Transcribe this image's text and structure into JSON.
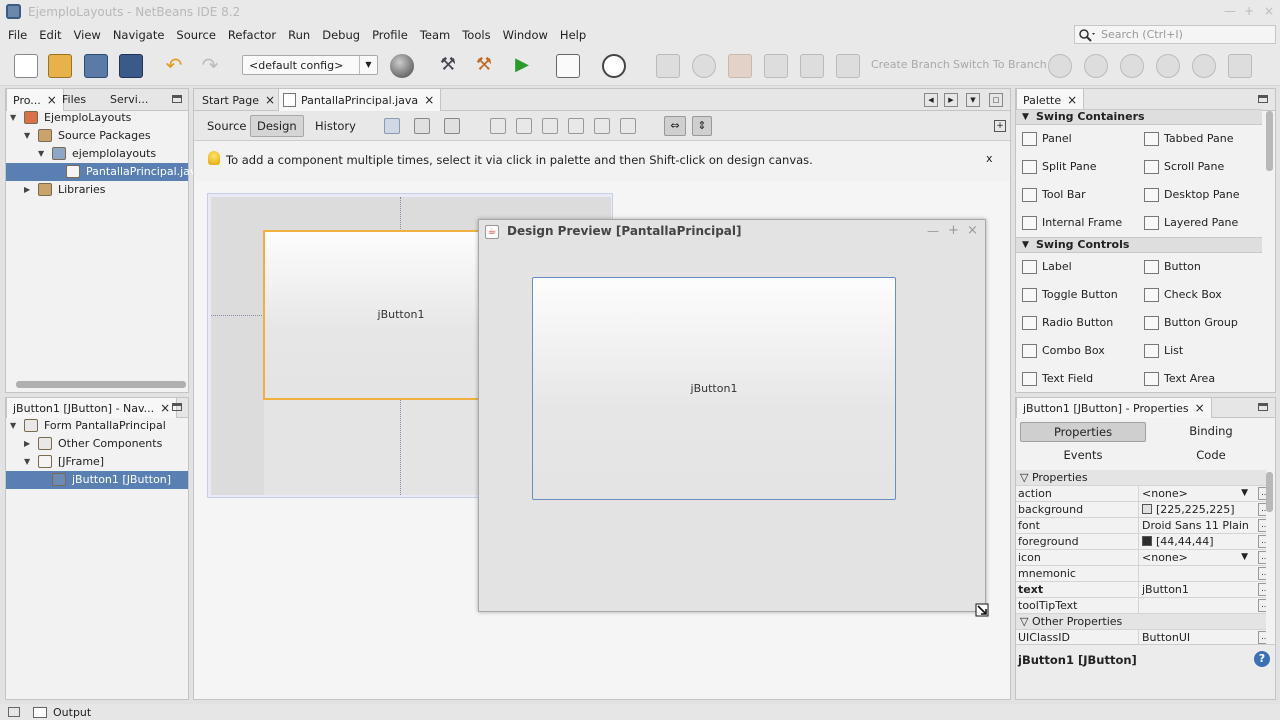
{
  "window": {
    "title": "EjemploLayouts - NetBeans IDE 8.2"
  },
  "menu": [
    "File",
    "Edit",
    "View",
    "Navigate",
    "Source",
    "Refactor",
    "Run",
    "Debug",
    "Profile",
    "Team",
    "Tools",
    "Window",
    "Help"
  ],
  "search": {
    "placeholder": "Search (Ctrl+I)"
  },
  "toolbar": {
    "config": "<default config>",
    "create_branch": "Create Branch",
    "switch_branch": "Switch To Branch"
  },
  "projects": {
    "tabs": [
      "Pro...",
      "Files",
      "Servi..."
    ],
    "tree": [
      {
        "label": "EjemploLayouts",
        "level": 0
      },
      {
        "label": "Source Packages",
        "level": 1
      },
      {
        "label": "ejemplolayouts",
        "level": 2
      },
      {
        "label": "PantallaPrincipal.java",
        "level": 3,
        "selected": true
      },
      {
        "label": "Libraries",
        "level": 1
      }
    ]
  },
  "navigator": {
    "title": "jButton1 [JButton] - Nav...",
    "tree": [
      {
        "label": "Form PantallaPrincipal",
        "level": 0
      },
      {
        "label": "Other Components",
        "level": 1
      },
      {
        "label": "[JFrame]",
        "level": 1
      },
      {
        "label": "jButton1 [JButton]",
        "level": 2,
        "selected": true
      }
    ]
  },
  "editor": {
    "tabs": [
      "Start Page",
      "PantallaPrincipal.java"
    ],
    "views": [
      "Source",
      "Design",
      "History"
    ],
    "hint": "To add a component multiple times, select it via click in palette and then Shift-click on design canvas.",
    "hint_close": "x",
    "button_label": "jButton1"
  },
  "preview": {
    "title": "Design Preview [PantallaPrincipal]",
    "button_label": "jButton1"
  },
  "palette": {
    "title": "Palette",
    "sections": [
      {
        "name": "Swing Containers",
        "items": [
          "Panel",
          "Tabbed Pane",
          "Split Pane",
          "Scroll Pane",
          "Tool Bar",
          "Desktop Pane",
          "Internal Frame",
          "Layered Pane"
        ]
      },
      {
        "name": "Swing Controls",
        "items": [
          "Label",
          "Button",
          "Toggle Button",
          "Check Box",
          "Radio Button",
          "Button Group",
          "Combo Box",
          "List",
          "Text Field",
          "Text Area"
        ]
      }
    ]
  },
  "properties": {
    "title": "jButton1 [JButton] - Properties",
    "tabs": [
      "Properties",
      "Binding",
      "Events",
      "Code"
    ],
    "section": "Properties",
    "rows": [
      {
        "k": "action",
        "v": "<none>"
      },
      {
        "k": "background",
        "v": "[225,225,225]",
        "color": "#e1e1e1"
      },
      {
        "k": "font",
        "v": "Droid Sans 11 Plain"
      },
      {
        "k": "foreground",
        "v": "[44,44,44]",
        "color": "#2c2c2c"
      },
      {
        "k": "icon",
        "v": "<none>"
      },
      {
        "k": "mnemonic",
        "v": ""
      },
      {
        "k": "text",
        "v": "jButton1",
        "bold": true
      },
      {
        "k": "toolTipText",
        "v": ""
      }
    ],
    "other_section": "Other Properties",
    "other_rows": [
      {
        "k": "UIClassID",
        "v": "ButtonUI"
      }
    ],
    "footer": "jButton1 [JButton]"
  },
  "status": {
    "output": "Output"
  }
}
